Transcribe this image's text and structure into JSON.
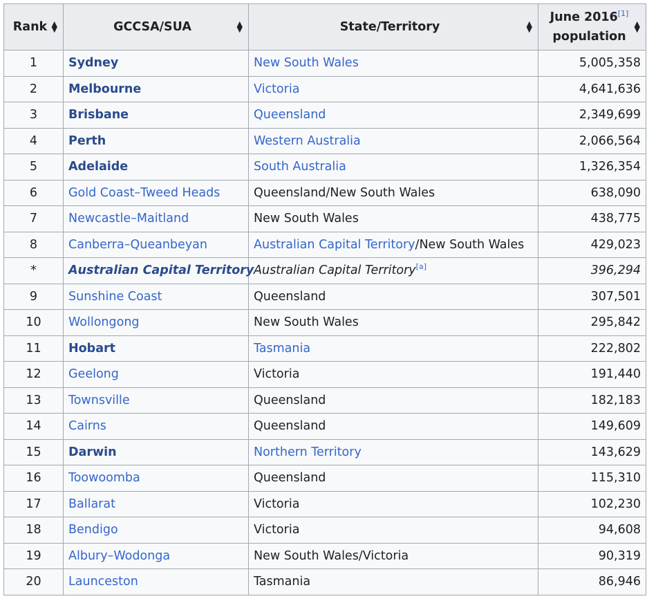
{
  "headers": {
    "rank": "Rank",
    "gccsa": "GCCSA/SUA",
    "state": "State/Territory",
    "pop_line1": "June 2016",
    "pop_ref": "[1]",
    "pop_line2": "population"
  },
  "rows": [
    {
      "rank": "1",
      "name": "Sydney",
      "state": "New South Wales",
      "population": "5,005,358"
    },
    {
      "rank": "2",
      "name": "Melbourne",
      "state": "Victoria",
      "population": "4,641,636"
    },
    {
      "rank": "3",
      "name": "Brisbane",
      "state": "Queensland",
      "population": "2,349,699"
    },
    {
      "rank": "4",
      "name": "Perth",
      "state": "Western Australia",
      "population": "2,066,564"
    },
    {
      "rank": "5",
      "name": "Adelaide",
      "state": "South Australia",
      "population": "1,326,354"
    },
    {
      "rank": "6",
      "name": "Gold Coast–Tweed Heads",
      "state": "Queensland/New South Wales",
      "population": "638,090"
    },
    {
      "rank": "7",
      "name": "Newcastle–Maitland",
      "state": "New South Wales",
      "population": "438,775"
    },
    {
      "rank": "8",
      "name": "Canberra–Queanbeyan",
      "state_link": "Australian Capital Territory",
      "state": "/New South Wales",
      "population": "429,023"
    },
    {
      "rank": "*",
      "name": "Australian Capital Territory",
      "state": "Australian Capital Territory",
      "state_ref": "[a]",
      "population": "396,294"
    },
    {
      "rank": "9",
      "name": "Sunshine Coast",
      "state": "Queensland",
      "population": "307,501"
    },
    {
      "rank": "10",
      "name": "Wollongong",
      "state": "New South Wales",
      "population": "295,842"
    },
    {
      "rank": "11",
      "name": "Hobart",
      "state": "Tasmania",
      "population": "222,802"
    },
    {
      "rank": "12",
      "name": "Geelong",
      "state": "Victoria",
      "population": "191,440"
    },
    {
      "rank": "13",
      "name": "Townsville",
      "state": "Queensland",
      "population": "182,183"
    },
    {
      "rank": "14",
      "name": "Cairns",
      "state": "Queensland",
      "population": "149,609"
    },
    {
      "rank": "15",
      "name": "Darwin",
      "state": "Northern Territory",
      "population": "143,629"
    },
    {
      "rank": "16",
      "name": "Toowoomba",
      "state": "Queensland",
      "population": "115,310"
    },
    {
      "rank": "17",
      "name": "Ballarat",
      "state": "Victoria",
      "population": "102,230"
    },
    {
      "rank": "18",
      "name": "Bendigo",
      "state": "Victoria",
      "population": "94,608"
    },
    {
      "rank": "19",
      "name": "Albury–Wodonga",
      "state": "New South Wales/Victoria",
      "population": "90,319"
    },
    {
      "rank": "20",
      "name": "Launceston",
      "state": "Tasmania",
      "population": "86,946"
    }
  ],
  "colors": {
    "link": "#3366cc",
    "capital_link": "#2a4b8d",
    "header_bg": "#eaecf0",
    "border": "#a2a9b1"
  }
}
